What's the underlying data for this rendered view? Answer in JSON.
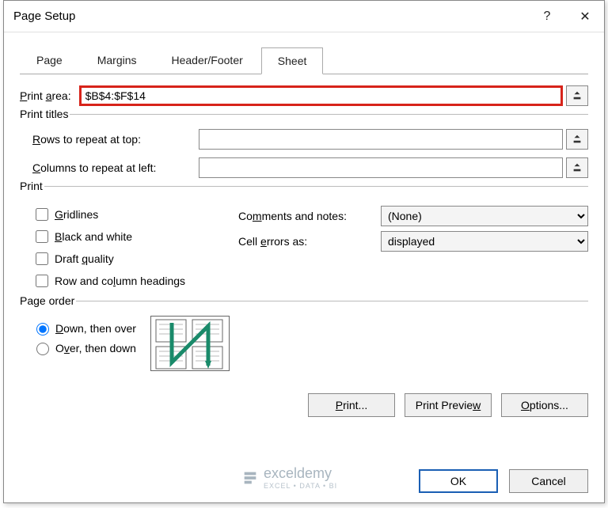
{
  "dialog": {
    "title": "Page Setup"
  },
  "tabs": {
    "page": "Page",
    "margins": "Margins",
    "header_footer": "Header/Footer",
    "sheet": "Sheet"
  },
  "print_area": {
    "label": "Print area:",
    "value": "$B$4:$F$14"
  },
  "titles": {
    "group": "Print titles",
    "rows_label": "Rows to repeat at top:",
    "rows_value": "",
    "cols_label": "Columns to repeat at left:",
    "cols_value": ""
  },
  "print": {
    "group": "Print",
    "gridlines": "Gridlines",
    "bw": "Black and white",
    "draft": "Draft quality",
    "rowcol": "Row and column headings",
    "comments_label": "Comments and notes:",
    "comments_value": "(None)",
    "errors_label": "Cell errors as:",
    "errors_value": "displayed"
  },
  "order": {
    "group": "Page order",
    "down": "Down, then over",
    "over": "Over, then down"
  },
  "buttons": {
    "print": "Print...",
    "preview": "Print Preview",
    "options": "Options...",
    "ok": "OK",
    "cancel": "Cancel"
  },
  "watermark": {
    "brand": "exceldemy",
    "sub": "EXCEL • DATA • BI"
  }
}
